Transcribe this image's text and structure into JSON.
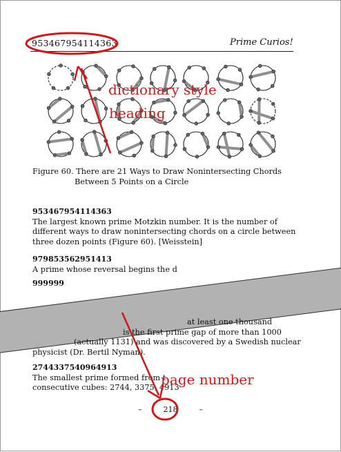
{
  "header": {
    "left": "953467954114363",
    "right": "Prime Curios!"
  },
  "figure": {
    "caption_line1": "Figure 60.  There are 21 Ways to Draw Nonintersecting Chords",
    "caption_line2": "Between 5 Points on a Circle"
  },
  "entries": [
    {
      "number": "953467954114363",
      "lines": [
        "The largest known prime Motzkin number.  It is the number of",
        "different ways to draw nonintersecting chords on a circle between",
        "three dozen points (Figure 60).  [Weisstein]"
      ]
    },
    {
      "number": "979853562951413",
      "lines": [
        "A prime whose reversal begins the d"
      ]
    },
    {
      "number": "999999",
      "lines": [
        "",
        "is the first prime gap of more than 1000",
        "(actually 1131) and was discovered by a Swedish nuclear",
        "physicist (Dr. Bertil Nyman)."
      ],
      "partial_line": "at least one thousand"
    },
    {
      "number": "2744337540964913",
      "lines": [
        "The smallest prime formed from t",
        "consecutive cubes: 2744, 3375, 4913"
      ]
    }
  ],
  "footer": {
    "page": "218",
    "dash": "–"
  },
  "annotations": {
    "heading_label_1": "dictionary style",
    "heading_label_2": "heading",
    "page_label": "page number",
    "color": "#cc1a1a"
  }
}
